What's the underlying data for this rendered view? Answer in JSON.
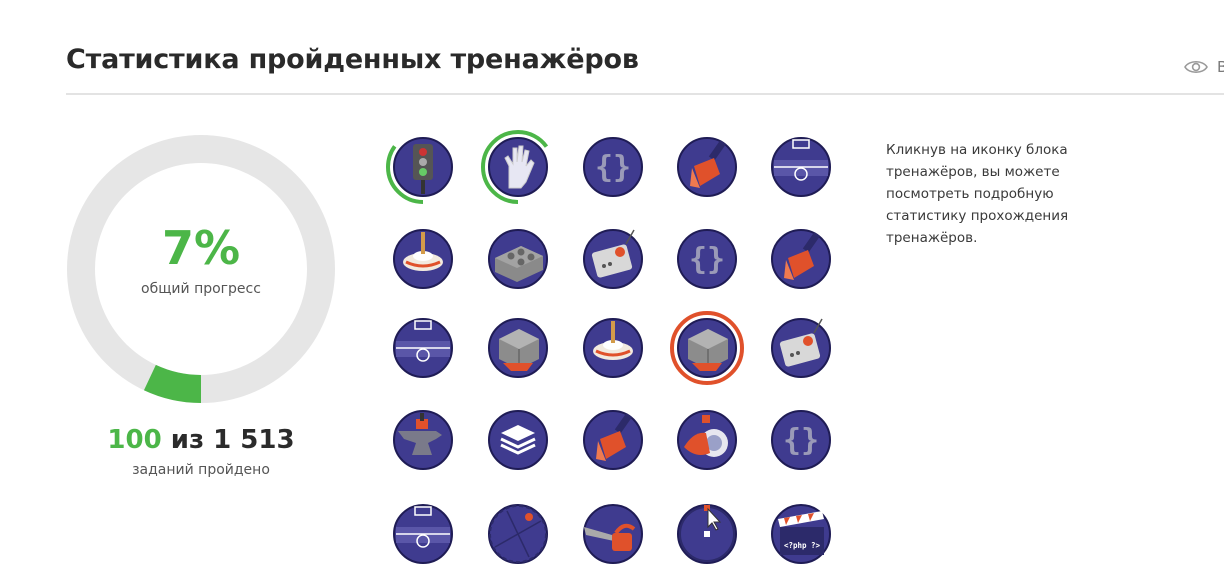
{
  "header": {
    "title": "Статистика пройденных тренажёров",
    "eye_label": "В"
  },
  "progress": {
    "percent_text": "7%",
    "percent_value": 7,
    "caption": "общий прогресс",
    "done": "100",
    "of_word": "из",
    "total": "1 513",
    "done_caption": "заданий пройдено"
  },
  "hint": "Кликнув на иконку блока тренажёров, вы можете посмотреть подробную статистику прохождения тренажёров.",
  "colors": {
    "accent_green": "#4cb648",
    "badge_purple": "#3f3b8f",
    "selected_ring": "#e0512b",
    "ring_track": "#e6e6e6"
  },
  "trainer_grid": [
    {
      "icon": "traffic-light-icon",
      "progress": 0.35
    },
    {
      "icon": "hand-icon",
      "progress": 0.65
    },
    {
      "icon": "curly-braces-icon",
      "progress": 0
    },
    {
      "icon": "paint-brush-icon",
      "progress": 0
    },
    {
      "icon": "football-field-icon",
      "progress": 0
    },
    {
      "icon": "spinning-top-icon",
      "progress": 0
    },
    {
      "icon": "lego-brick-icon",
      "progress": 0
    },
    {
      "icon": "control-box-icon",
      "progress": 0
    },
    {
      "icon": "curly-braces-icon",
      "progress": 0
    },
    {
      "icon": "paint-brush-icon",
      "progress": 0
    },
    {
      "icon": "football-field-icon",
      "progress": 0
    },
    {
      "icon": "rubiks-cube-icon",
      "progress": 0
    },
    {
      "icon": "spinning-top-icon",
      "progress": 0
    },
    {
      "icon": "rubiks-cube-icon",
      "progress": 0,
      "selected": true
    },
    {
      "icon": "control-box-icon",
      "progress": 0
    },
    {
      "icon": "anvil-icon",
      "progress": 0
    },
    {
      "icon": "box-stack-icon",
      "progress": 0
    },
    {
      "icon": "paint-brush-icon",
      "progress": 0
    },
    {
      "icon": "diving-helmet-icon",
      "progress": 0
    },
    {
      "icon": "curly-braces-icon",
      "progress": 0
    },
    {
      "icon": "football-field-icon",
      "progress": 0
    },
    {
      "icon": "compass-circle-icon",
      "progress": 0
    },
    {
      "icon": "chainsaw-icon",
      "progress": 0
    },
    {
      "icon": "vector-cursor-icon",
      "progress": 0
    },
    {
      "icon": "clapperboard-icon",
      "progress": 0,
      "text": "<?php ?>"
    }
  ]
}
